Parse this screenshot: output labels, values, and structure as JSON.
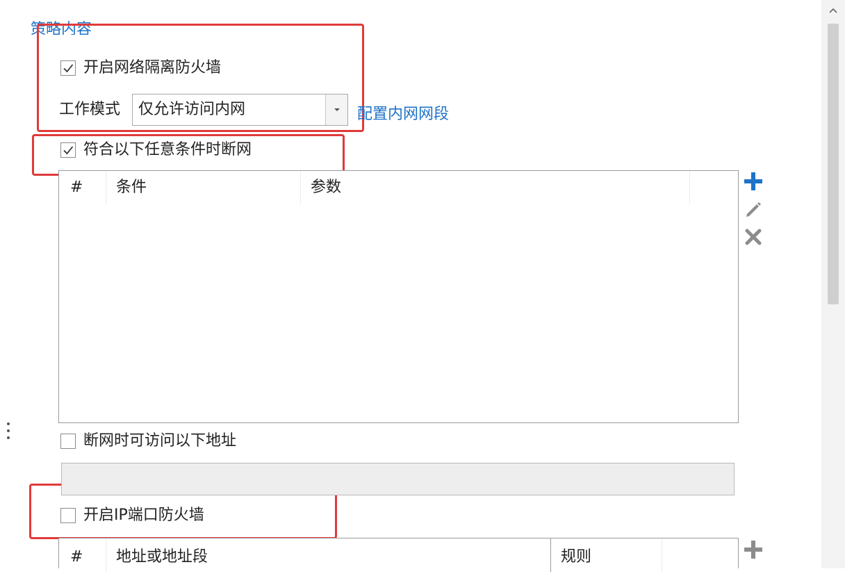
{
  "section": {
    "title": "策略内容"
  },
  "network_isolation": {
    "label": "开启网络隔离防火墙",
    "checked": true,
    "work_mode_label": "工作模式",
    "work_mode_value": "仅允许访问内网",
    "config_link": "配置内网网段"
  },
  "disconnect_rule": {
    "label": "符合以下任意条件时断网",
    "checked": true
  },
  "conditions_table": {
    "columns": [
      "#",
      "条件",
      "参数"
    ],
    "rows": []
  },
  "allowed_addresses": {
    "label": "断网时可访问以下地址",
    "checked": false,
    "value": ""
  },
  "ip_port_firewall": {
    "label": "开启IP端口防火墙",
    "checked": false
  },
  "ip_table": {
    "columns": [
      "#",
      "地址或地址段",
      "规则"
    ]
  },
  "icons": {
    "add": "plus-icon",
    "edit": "pencil-icon",
    "delete": "close-icon"
  },
  "colors": {
    "accent": "#1e73c8",
    "highlight": "#e03a3a",
    "icon_gray": "#8c8c8c"
  }
}
